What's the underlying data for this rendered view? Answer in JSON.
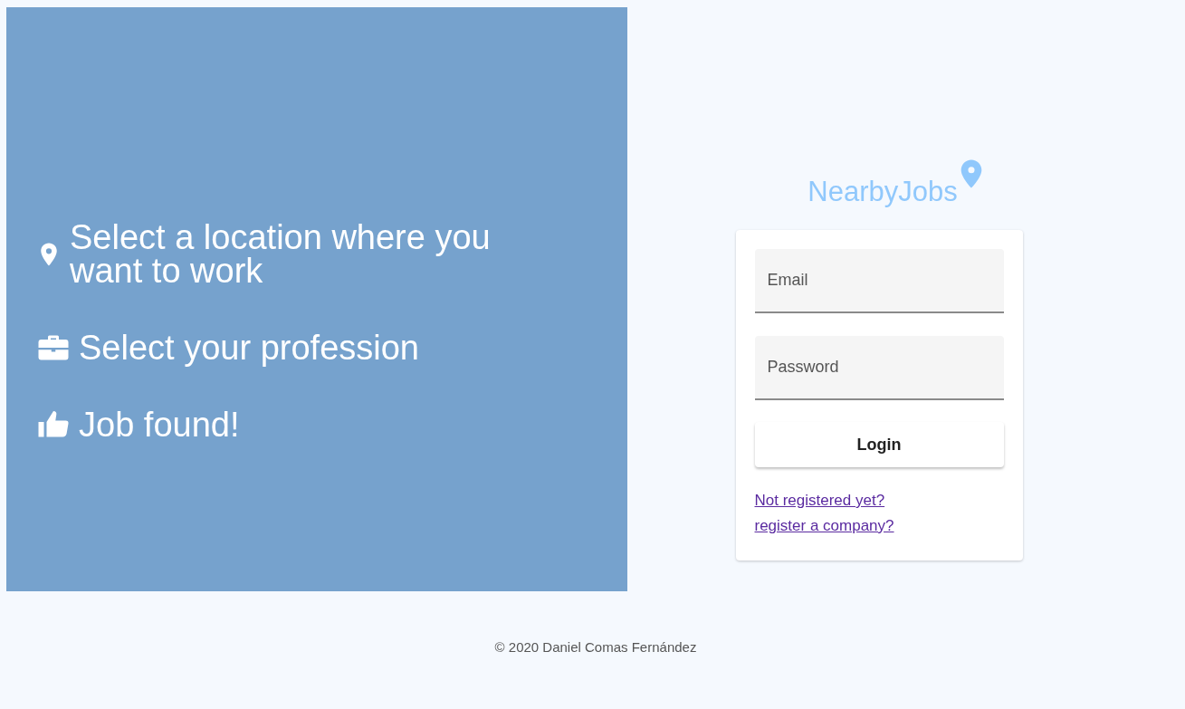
{
  "features": [
    {
      "kind": "location",
      "text": "Select a location where you want to work"
    },
    {
      "kind": "profession",
      "text": "Select your profession"
    },
    {
      "kind": "found",
      "text": "Job found!"
    }
  ],
  "brand": {
    "name": "NearbyJobs"
  },
  "login_form": {
    "email": {
      "placeholder": "Email"
    },
    "password": {
      "placeholder": "Password"
    },
    "button": "Login",
    "links": [
      "Not registered yet?",
      "register a company?"
    ]
  },
  "footer": "© 2020 Daniel Comas Fernández"
}
